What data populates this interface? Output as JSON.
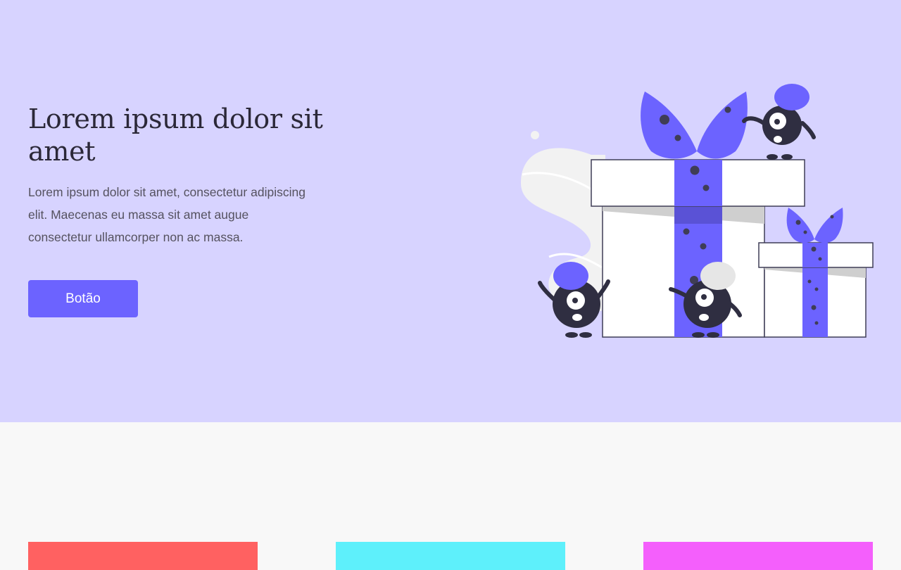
{
  "hero": {
    "title": "Lorem ipsum dolor sit amet",
    "text": "Lorem ipsum dolor sit amet, consectetur adipiscing elit. Maecenas eu massa sit amet augue consectetur ullamcorper non ac massa.",
    "button_label": "Botão",
    "background_color": "#d7d3ff",
    "accent_color": "#6c63ff",
    "illustration_icon": "gift-boxes-with-monsters-illustration"
  },
  "cards": [
    {
      "color": "#ff6161"
    },
    {
      "color": "#5ef0fb"
    },
    {
      "color": "#f45ffc"
    }
  ]
}
